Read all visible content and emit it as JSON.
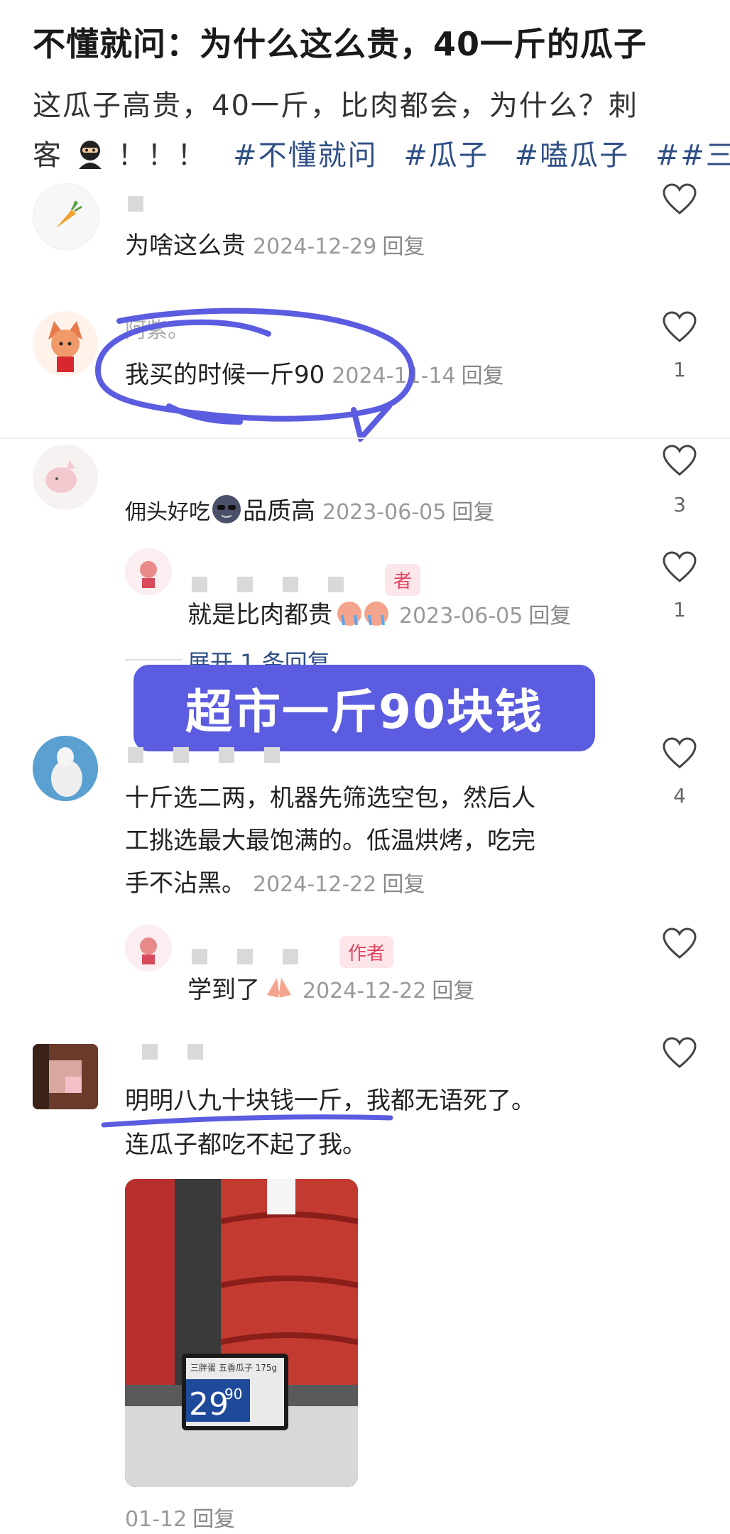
{
  "post": {
    "title": "不懂就问：为什么这么贵，40一斤的瓜子",
    "body_line1": "这瓜子高贵，40一斤，比肉都会，为什么？刺",
    "body_line2_prefix": "客",
    "body_line2_exclaim": "！！！",
    "tags": [
      "#不懂就问",
      "#瓜子",
      "#嗑瓜子",
      "##三"
    ]
  },
  "comments": [
    {
      "text": "为啥这么贵",
      "date": "2024-12-29",
      "reply": "回复",
      "likes": ""
    },
    {
      "username": "阿紫。",
      "text": "我买的时候一斤90",
      "date": "2024-11-14",
      "reply": "回复",
      "likes": "1"
    },
    {
      "text": "佣头好吃",
      "text2": "品质高",
      "date": "2023-06-05",
      "reply": "回复",
      "likes": "3"
    },
    {
      "badge": "者",
      "text": "就是比肉都贵",
      "date": "2023-06-05",
      "reply": "回复",
      "likes": "1"
    },
    {
      "expand": "展开 1 条回复"
    },
    {
      "text_line1": "十斤选二两，机器先筛选空包，然后人",
      "text_line2": "工挑选最大最饱满的。低温烘烤，吃完",
      "text_line3": "手不沾黑。",
      "date": "2024-12-22",
      "reply": "回复",
      "likes": "4"
    },
    {
      "badge": "作者",
      "text": "学到了",
      "date": "2024-12-22",
      "reply": "回复",
      "likes": ""
    },
    {
      "text_line1": "明明八九十块钱一斤，我都无语死了。",
      "text_line2": "连瓜子都吃不起了我。",
      "date": "01-12",
      "reply": "回复",
      "likes": ""
    }
  ],
  "overlay": {
    "caption": "超市一斤90块钱"
  },
  "photo": {
    "brand": "三胖蛋",
    "price_big": "29",
    "price_small": "90",
    "product": "三胖蛋 五香瓜子 175g"
  },
  "colors": {
    "annotation": "#5b5ce0",
    "tag": "#2f4f86",
    "badge": "#e0455f"
  }
}
